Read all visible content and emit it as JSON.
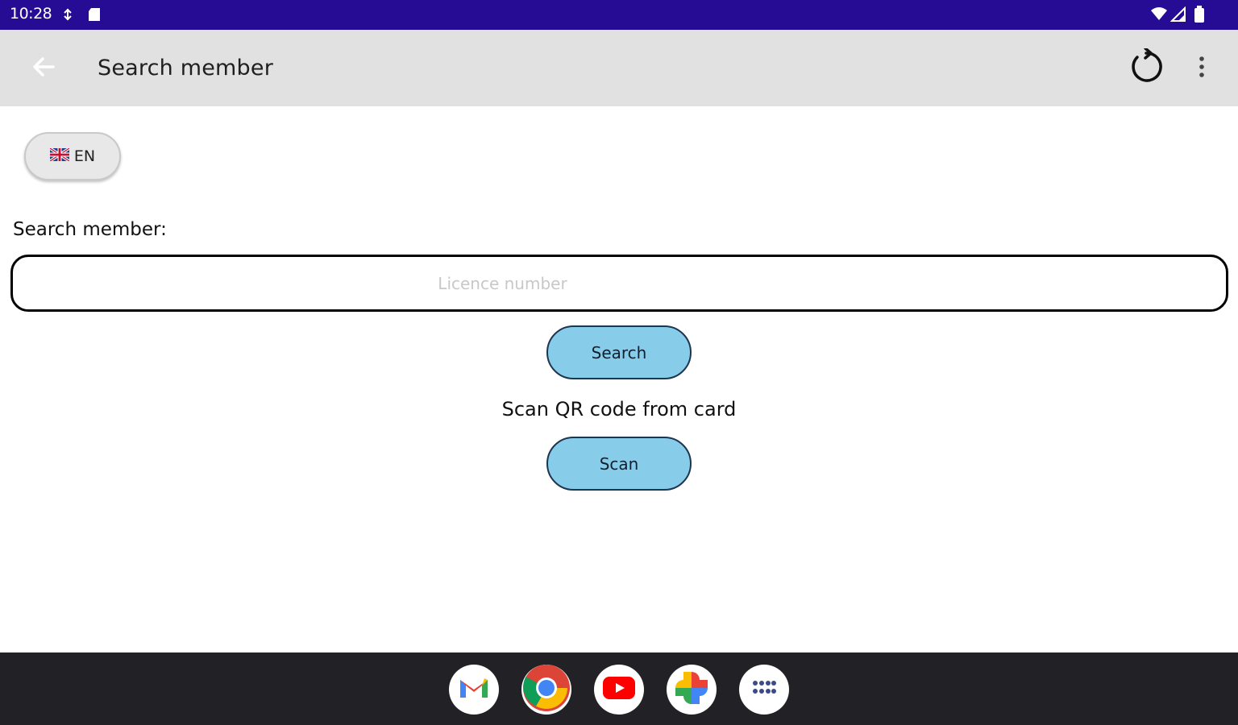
{
  "status_bar": {
    "time": "10:28",
    "icons": [
      "data-saver-icon",
      "sd-card-icon",
      "wifi-icon",
      "signal-icon",
      "battery-icon"
    ],
    "bg_color": "#260c94"
  },
  "app_bar": {
    "title": "Search member",
    "back_icon": "arrow-back-icon",
    "refresh_icon": "refresh-icon",
    "menu_icon": "more-vert-icon"
  },
  "language": {
    "code": "EN",
    "flag_icon": "uk-flag-icon"
  },
  "search": {
    "label": "Search member:",
    "placeholder": "Licence number",
    "value": "",
    "button_label": "Search"
  },
  "scan": {
    "caption": "Scan QR code from card",
    "button_label": "Scan"
  },
  "colors": {
    "button_fill": "#87cdea",
    "taskbar": "#222226"
  },
  "taskbar": {
    "apps": [
      "gmail-icon",
      "chrome-icon",
      "youtube-icon",
      "photos-icon",
      "app-drawer-icon"
    ]
  }
}
